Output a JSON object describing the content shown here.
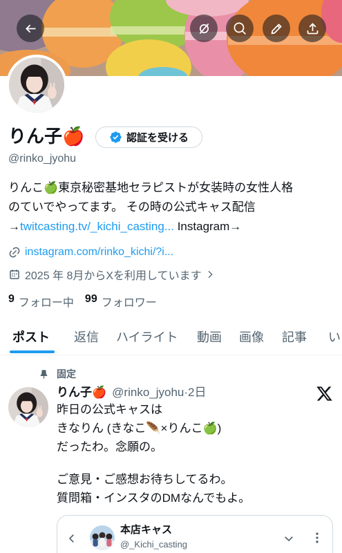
{
  "colors": {
    "text": "#0f1419",
    "secondary_text": "#536471",
    "accent_blue": "#1d9bf0",
    "divider": "#eff3f4",
    "button_border": "#cfd9de"
  },
  "header": {
    "back_icon": "back-arrow-icon",
    "action_icons": [
      "grok-icon",
      "search-icon",
      "edit-icon",
      "share-icon"
    ]
  },
  "profile": {
    "name": "りん子🍎",
    "verify_label": "認証を受ける",
    "verify_icon": "verified-badge-icon",
    "handle": "@rinko_jyohu",
    "bio": {
      "line1": "りんこ🍏東京秘密基地セラピストが女装時の女性人格",
      "line2": "のていでやってます。 その時の公式キャス配信",
      "line3_arrow": "→",
      "line3_link": "twitcasting.tv/_kichi_casting...",
      "line3_rest": " Instagram→"
    },
    "website_icon": "link-icon",
    "website": "instagram.com/rinko_kichi/?i...",
    "joined_icon": "calendar-icon",
    "joined": "2025 年 8月からXを利用しています",
    "following": {
      "count": "9",
      "label": "フォロー中"
    },
    "followers": {
      "count": "99",
      "label": "フォロワー"
    }
  },
  "tabs": [
    {
      "label": "ポスト",
      "active": true
    },
    {
      "label": "返信",
      "active": false
    },
    {
      "label": "ハイライト",
      "active": false
    },
    {
      "label": "動画",
      "active": false
    },
    {
      "label": "画像",
      "active": false
    },
    {
      "label": "記事",
      "active": false
    },
    {
      "label": "い",
      "active": false
    }
  ],
  "pinned_post": {
    "pinned_icon": "pin-icon",
    "pinned_label": "固定",
    "author": {
      "name": "りん子🍎",
      "handle": "@rinko_jyohu",
      "separator": "·",
      "time": "2日"
    },
    "source_icon": "x-logo-icon",
    "paragraphs": [
      [
        "昨日の公式キャスは",
        "きなりん (きなこ🪶×りんこ🍏)",
        "だったわ。念願の。"
      ],
      [
        "ご意見・ご感想お待ちしてるわ。",
        "質問箱・インスタのDMなんでもよ。"
      ]
    ],
    "embed": {
      "title": "本店キャス",
      "handle": "@_Kichi_casting"
    }
  }
}
